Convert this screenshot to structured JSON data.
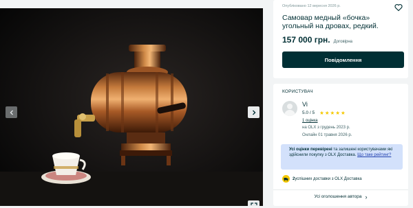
{
  "listing": {
    "published": "Опубліковано 12 вересня 2026 р.",
    "title": "Самовар медный «бочка» угольный на дровах, редкий.",
    "price": "157 000 грн.",
    "negotiable": "Договірна",
    "message_button": "Повідомлення"
  },
  "gallery": {
    "prev_icon": "chevron-left",
    "next_icon": "chevron-right",
    "fullscreen_icon": "expand"
  },
  "seller": {
    "section_title": "КОРИСТУВАЧ",
    "name": "Vi",
    "rating": "5.0 / 5",
    "stars": 5,
    "reviews_link": "1 оцінка",
    "since": "на OLX з грудень 2023 р.",
    "online": "Онлайн 01 травня 2026 р.",
    "info_bold": "Усі оцінки перевірені",
    "info_text": " та залишені користувачами які здійснили покупку з OLX Доставка.",
    "info_link": "Що таке рейтинг?",
    "delivery_count": "2",
    "delivery_text": " успішних доставки з OLX Доставка",
    "all_ads": "Усі оголошення автора"
  },
  "colors": {
    "primary": "#002f34",
    "star": "#f5c800",
    "info_bg": "#d3e1fb"
  }
}
